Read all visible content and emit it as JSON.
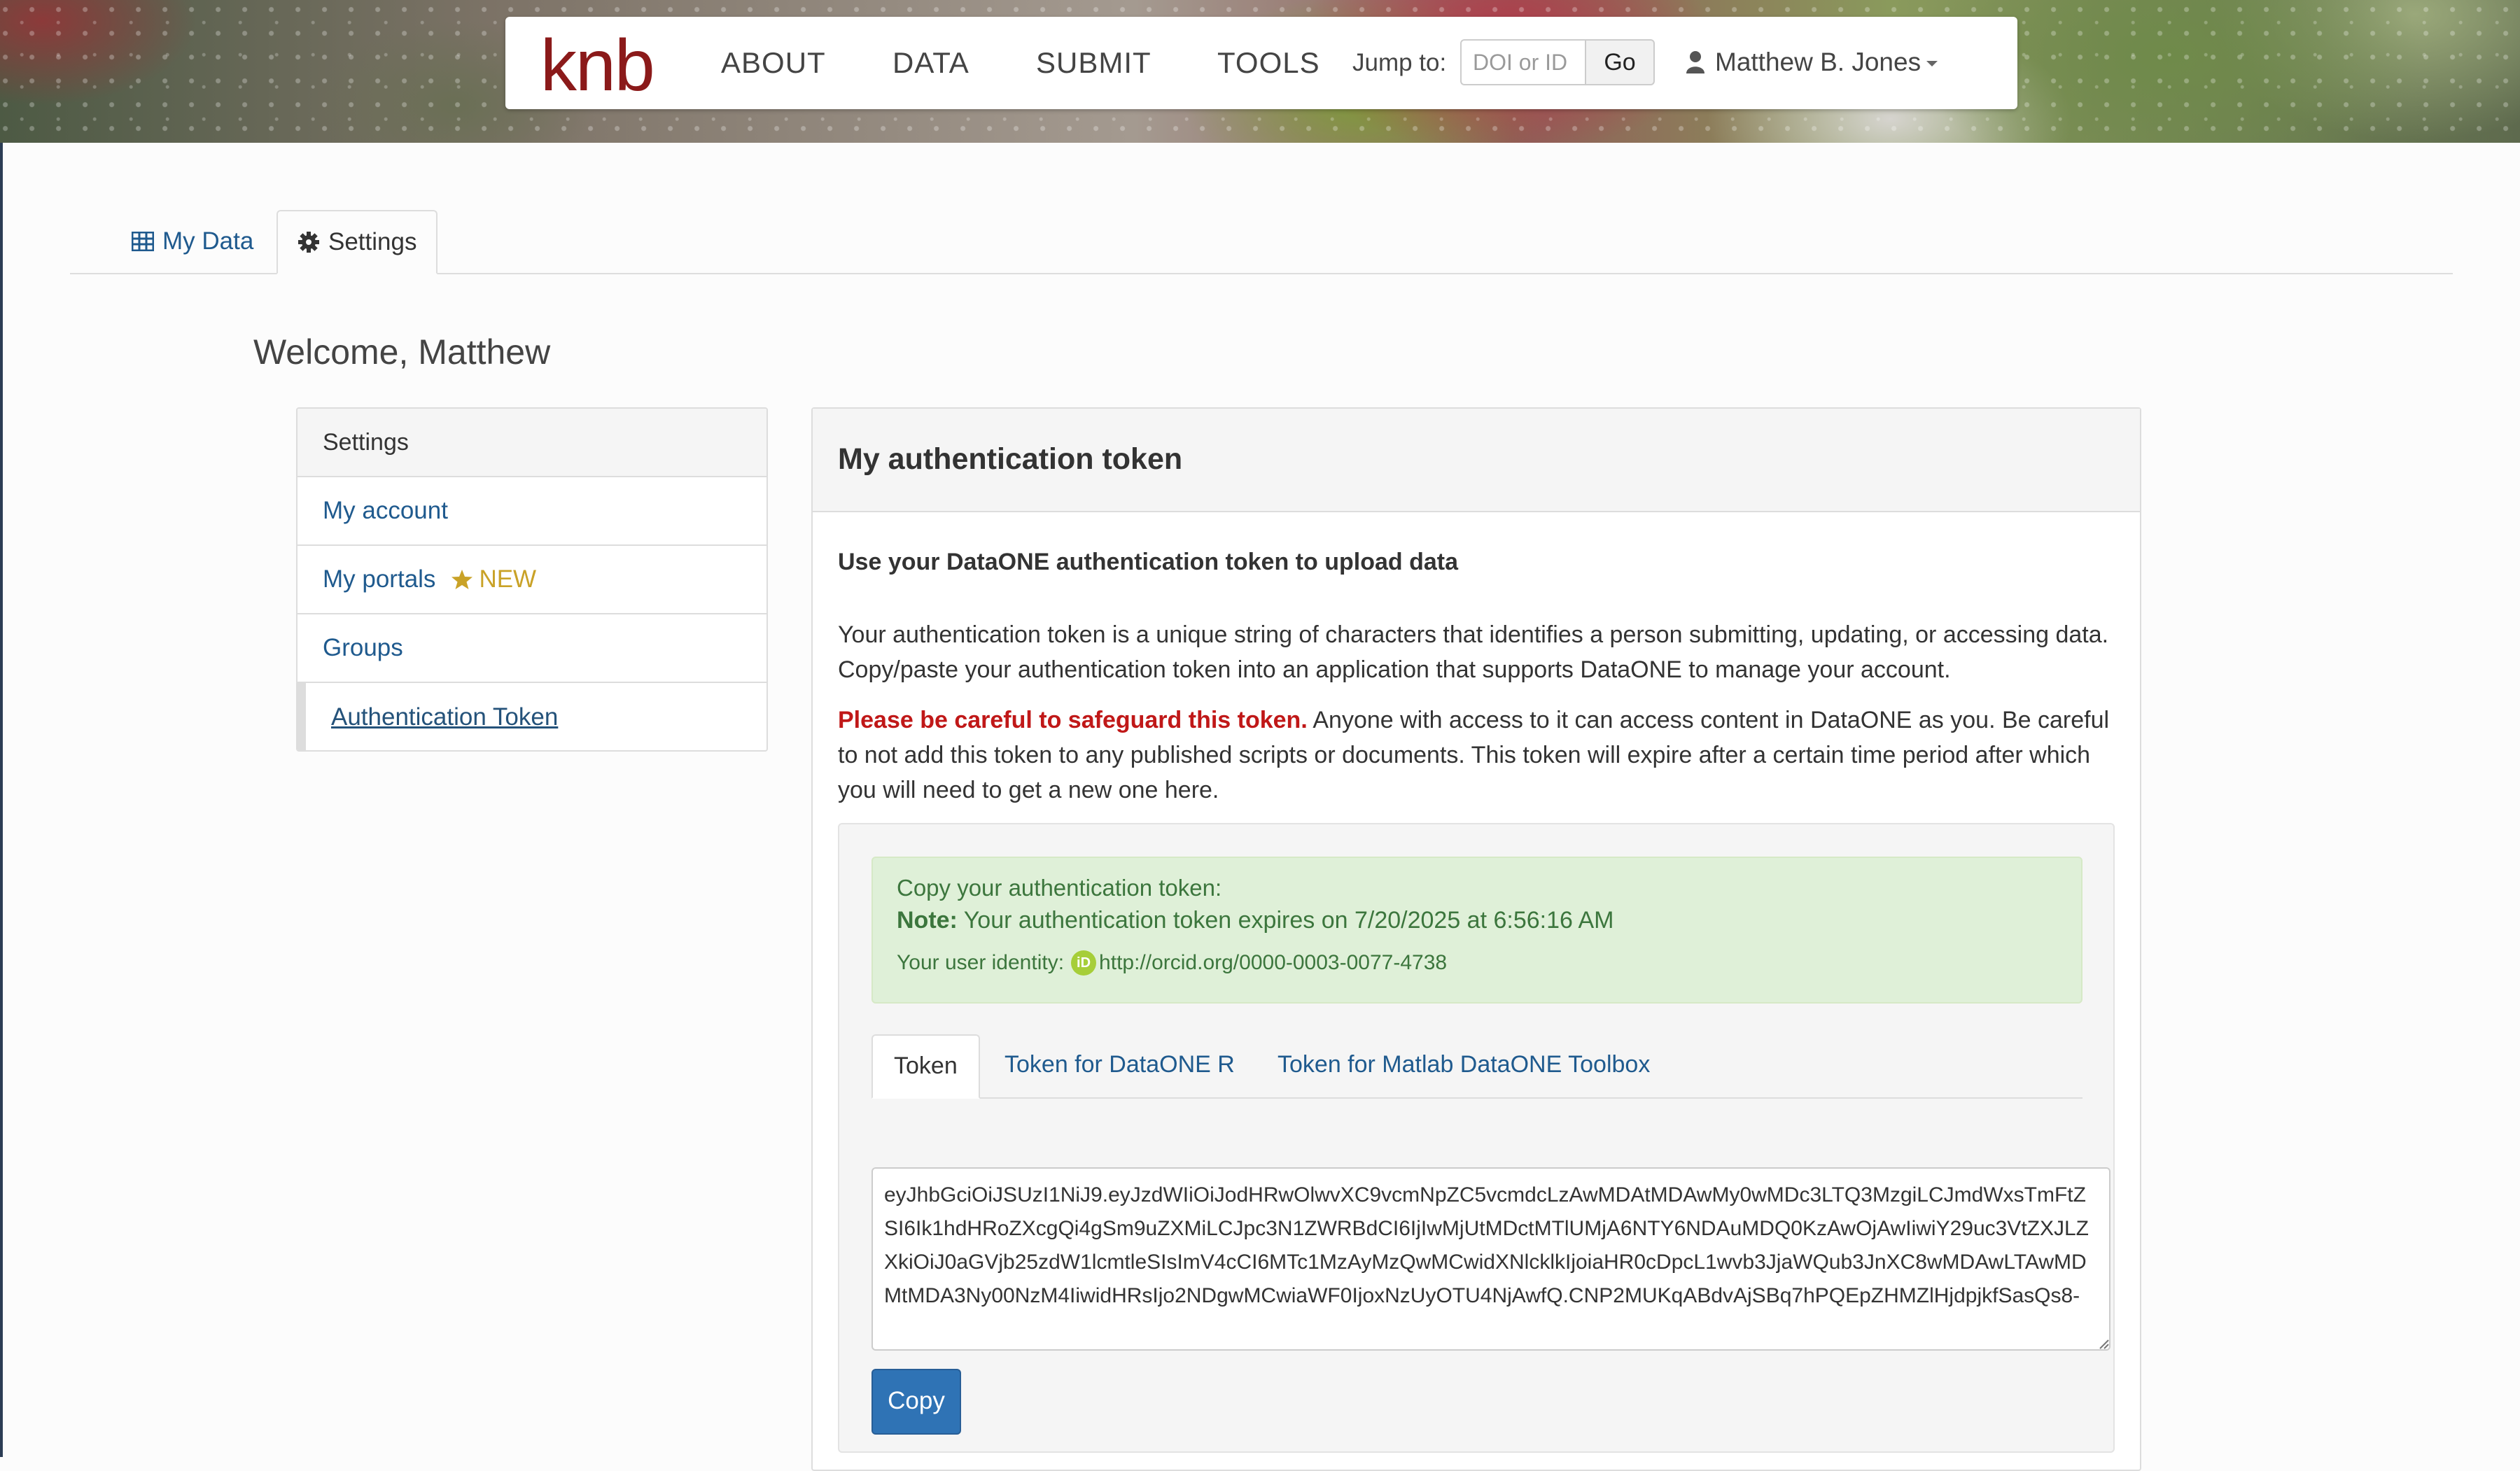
{
  "header": {
    "logo": "knb",
    "nav": [
      "ABOUT",
      "DATA",
      "SUBMIT",
      "TOOLS"
    ],
    "jump_label": "Jump to:",
    "jump_placeholder": "DOI or ID",
    "go_label": "Go",
    "user_name": "Matthew B. Jones"
  },
  "tabs": {
    "my_data": "My Data",
    "settings": "Settings"
  },
  "welcome": "Welcome, Matthew",
  "sidebar": {
    "title": "Settings",
    "items": [
      {
        "label": "My account"
      },
      {
        "label": "My portals",
        "badge": "NEW"
      },
      {
        "label": "Groups"
      },
      {
        "label": "Authentication Token"
      }
    ]
  },
  "panel": {
    "title": "My authentication token",
    "subheading": "Use your DataONE authentication token to upload data",
    "intro_line1": "Your authentication token is a unique string of characters that identifies a person submitting, updating, or accessing data.",
    "intro_line2": "Copy/paste your authentication token into an application that supports DataONE to manage your account.",
    "warning_bold": "Please be careful to safeguard this token.",
    "warning_rest": " Anyone with access to it can access content in DataONE as you. Be careful to not add this token to any published scripts or documents. This token will expire after a certain time period after which you will need to get a new one here.",
    "alert": {
      "line1": "Copy your authentication token:",
      "note_label": "Note:",
      "note_text": " Your authentication token expires on 7/20/2025 at 6:56:16 AM",
      "identity_label": "Your user identity:",
      "identity_value": "http://orcid.org/0000-0003-0077-4738"
    },
    "token_tabs": [
      "Token",
      "Token for DataONE R",
      "Token for Matlab DataONE Toolbox"
    ],
    "token_value": "eyJhbGciOiJSUzI1NiJ9.eyJzdWIiOiJodHRwOlwvXC9vcmNpZC5vcmdcLzAwMDAtMDAwMy0wMDc3LTQ3MzgiLCJmdWxsTmFtZSI6Ik1hdHRoZXcgQi4gSm9uZXMiLCJpc3N1ZWRBdCI6IjIwMjUtMDctMTlUMjA6NTY6NDAuMDQ0KzAwOjAwIiwiY29uc3VtZXJLZXkiOiJ0aGVjb25zdW1lcmtleSIsImV4cCI6MTc1MzAyMzQwMCwidXNlcklkIjoiaHR0cDpcL1wvb3JjaWQub3JnXC8wMDAwLTAwMDMtMDA3Ny00NzM4IiwidHRsIjo2NDgwMCwiaWF0IjoxNzUyOTU4NjAwfQ.CNP2MUKqABdvAjSBq7hPQEpZHMZlHjdpjkfSasQs8-",
    "copy_label": "Copy"
  },
  "colors": {
    "link": "#1f5a8e",
    "warning": "#c01818",
    "alert_bg": "#dff0d8",
    "alert_text": "#3c763d",
    "primary_button": "#2f73b5",
    "logo": "#8b1a1a",
    "badge": "#c9a227"
  },
  "icons": {
    "my_data": "table-icon",
    "settings": "gear-icon",
    "user": "user-icon",
    "new_badge": "star-icon",
    "orcid": "orcid-icon"
  }
}
